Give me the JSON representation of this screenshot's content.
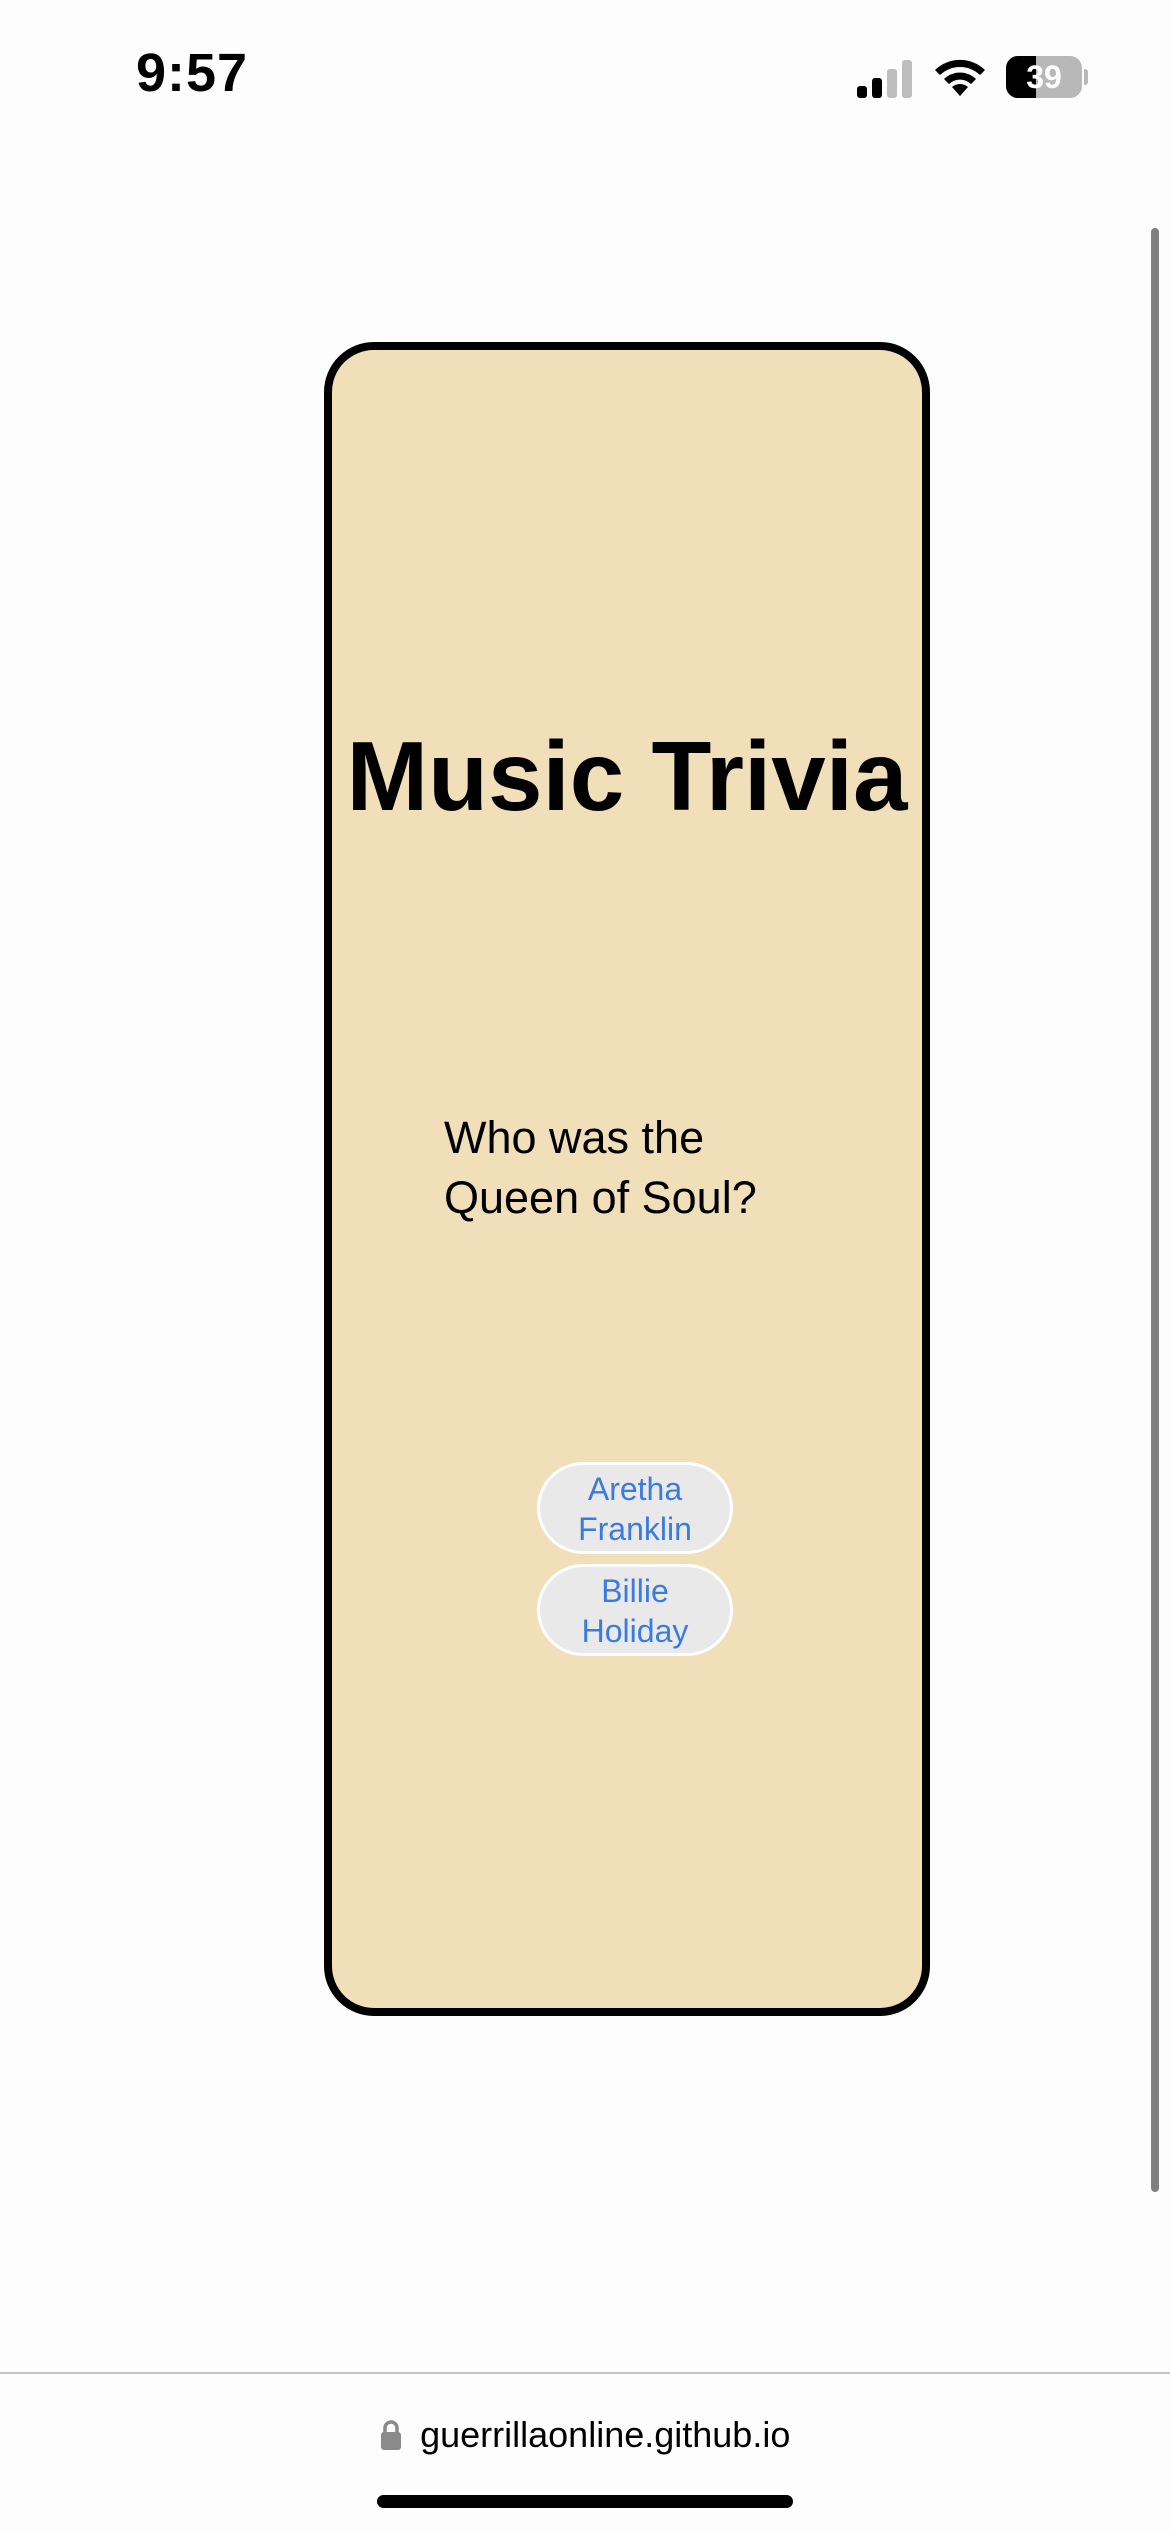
{
  "status_bar": {
    "time": "9:57",
    "battery_level": "39",
    "battery_fraction": 0.39,
    "signal_bars_active": 2,
    "signal_bars_total": 4,
    "icons": [
      "signal-icon",
      "wifi-icon",
      "battery-icon"
    ]
  },
  "card": {
    "title": "Music Trivia",
    "question": "Who was the Queen of Soul?",
    "answers": [
      {
        "label": "Aretha Franklin"
      },
      {
        "label": "Billie Holiday"
      }
    ],
    "background_color": "#f0dfb8",
    "border_color": "#000000",
    "answer_text_color": "#3a7be0"
  },
  "address_bar": {
    "url": "guerrillaonline.github.io",
    "lock_icon": "lock-icon"
  }
}
